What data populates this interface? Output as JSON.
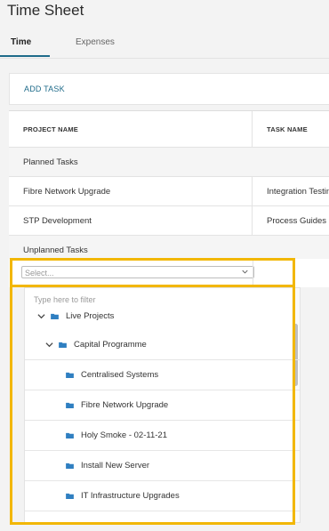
{
  "page": {
    "title": "Time Sheet"
  },
  "tabs": [
    {
      "label": "Time",
      "active": true
    },
    {
      "label": "Expenses",
      "active": false
    }
  ],
  "actions": {
    "add_task": "ADD TASK"
  },
  "table": {
    "headers": [
      "PROJECT NAME",
      "TASK NAME"
    ],
    "rows": [
      {
        "type": "group",
        "label": "Planned Tasks"
      },
      {
        "type": "data",
        "project": "Fibre Network Upgrade",
        "task": "Integration Testing"
      },
      {
        "type": "data",
        "project": "STP Development",
        "task": "Process Guides"
      },
      {
        "type": "group",
        "label": "Unplanned Tasks"
      }
    ]
  },
  "select": {
    "placeholder": "Select..."
  },
  "dropdown": {
    "filter_placeholder": "Type here to filter",
    "items": [
      {
        "label": "Live Projects",
        "expandable": true
      },
      {
        "label": "Capital Programme",
        "expandable": true
      },
      {
        "label": "Centralised Systems",
        "expandable": false
      },
      {
        "label": "Fibre Network Upgrade",
        "expandable": false
      },
      {
        "label": "Holy Smoke - 02-11-21",
        "expandable": false
      },
      {
        "label": "Install New Server",
        "expandable": false
      },
      {
        "label": "IT Infrastructure Upgrades",
        "expandable": false
      }
    ]
  },
  "colors": {
    "accent": "#1f6b8a",
    "folder": "#2f7fc1",
    "highlight": "#f2b705"
  }
}
